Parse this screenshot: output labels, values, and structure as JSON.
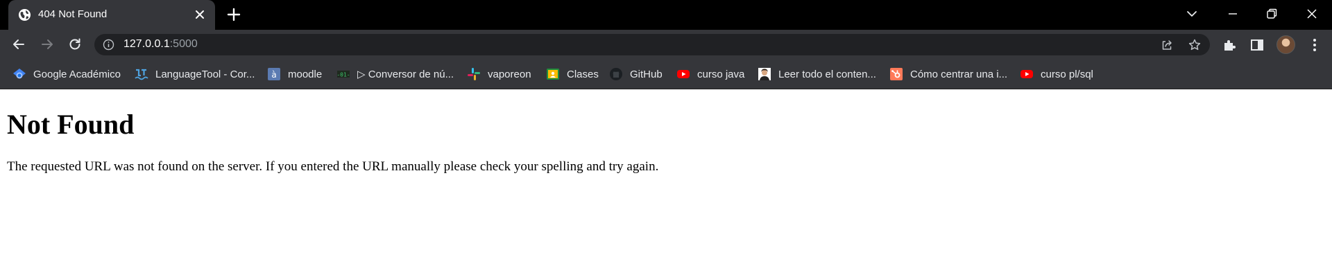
{
  "tab": {
    "title": "404 Not Found",
    "favicon": "globe-icon"
  },
  "address_bar": {
    "host": "127.0.0.1",
    "port": ":5000"
  },
  "bookmarks": [
    {
      "label": "Google Académico",
      "icon": "google-scholar-icon"
    },
    {
      "label": "LanguageTool - Cor...",
      "icon": "languagetool-icon"
    },
    {
      "label": "moodle",
      "icon": "moodle-icon"
    },
    {
      "label": "▷ Conversor de nú...",
      "icon": "binary-converter-icon"
    },
    {
      "label": "vaporeon",
      "icon": "slack-icon"
    },
    {
      "label": "Clases",
      "icon": "google-classroom-icon"
    },
    {
      "label": "GitHub",
      "icon": "github-icon"
    },
    {
      "label": "curso java",
      "icon": "youtube-icon"
    },
    {
      "label": "Leer todo el conten...",
      "icon": "person-photo-icon"
    },
    {
      "label": "Cómo centrar una i...",
      "icon": "hubspot-icon"
    },
    {
      "label": "curso pl/sql",
      "icon": "youtube-icon"
    }
  ],
  "page": {
    "heading": "Not Found",
    "message": "The requested URL was not found on the server. If you entered the URL manually please check your spelling and try again."
  },
  "colors": {
    "tab_strip": "#000000",
    "toolbar": "#35363a",
    "omnibox": "#202124",
    "page_background": "#ffffff"
  }
}
